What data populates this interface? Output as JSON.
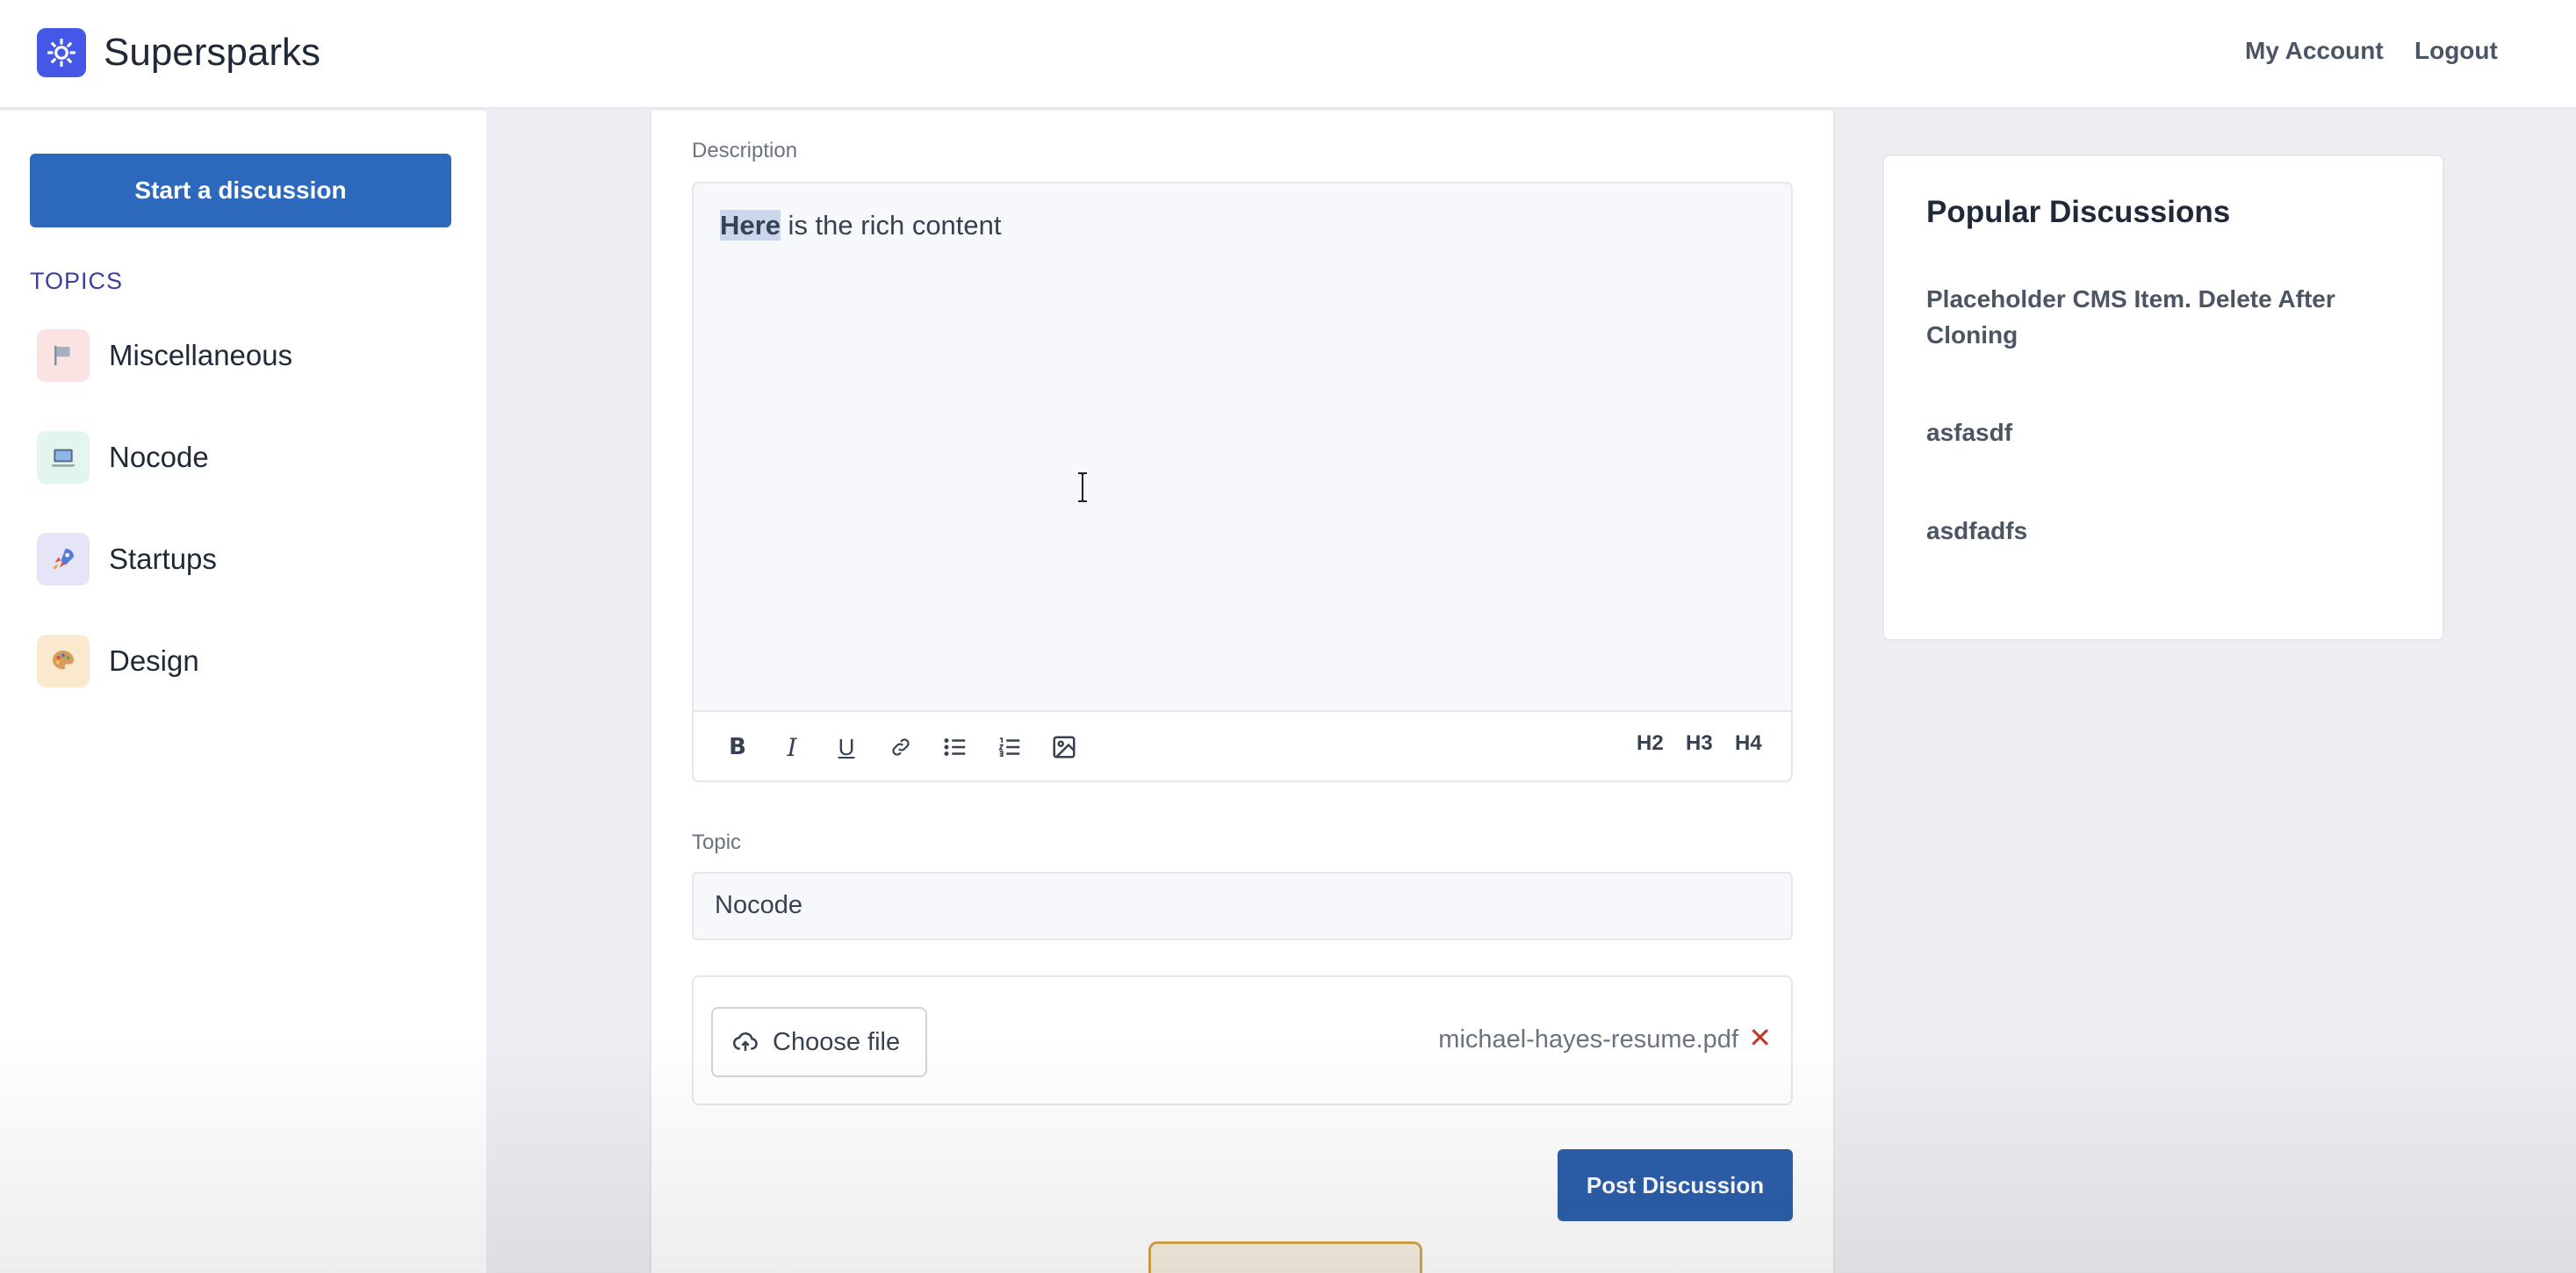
{
  "header": {
    "brand": "Supersparks",
    "nav": {
      "my_account": "My Account",
      "logout": "Logout"
    },
    "logo_icon": "sparkle-gear-icon",
    "accent_color": "#4457e6"
  },
  "sidebar": {
    "start_button": "Start a discussion",
    "topics_label": "TOPICS",
    "topics": [
      {
        "label": "Miscellaneous",
        "icon": "flag-icon",
        "icon_bg": "#fbe3e3"
      },
      {
        "label": "Nocode",
        "icon": "laptop-icon",
        "icon_bg": "#e2f6ee"
      },
      {
        "label": "Startups",
        "icon": "rocket-icon",
        "icon_bg": "#e6e4f7"
      },
      {
        "label": "Design",
        "icon": "palette-icon",
        "icon_bg": "#fbe9cf"
      }
    ]
  },
  "form": {
    "description_label": "Description",
    "description_highlight": "Here",
    "description_rest": " is the rich content",
    "toolbar": {
      "bold": "B",
      "italic": "I",
      "underline": "U",
      "h2": "H2",
      "h3": "H3",
      "h4": "H4"
    },
    "topic_label": "Topic",
    "topic_value": "Nocode",
    "choose_file": "Choose file",
    "file_name": "michael-hayes-resume.pdf",
    "post_button": "Post Discussion",
    "button_color": "#2c5fab"
  },
  "popular": {
    "title": "Popular Discussions",
    "items": [
      "Placeholder CMS Item. Delete After Cloning",
      "asfasdf",
      "asdfadfs"
    ]
  }
}
